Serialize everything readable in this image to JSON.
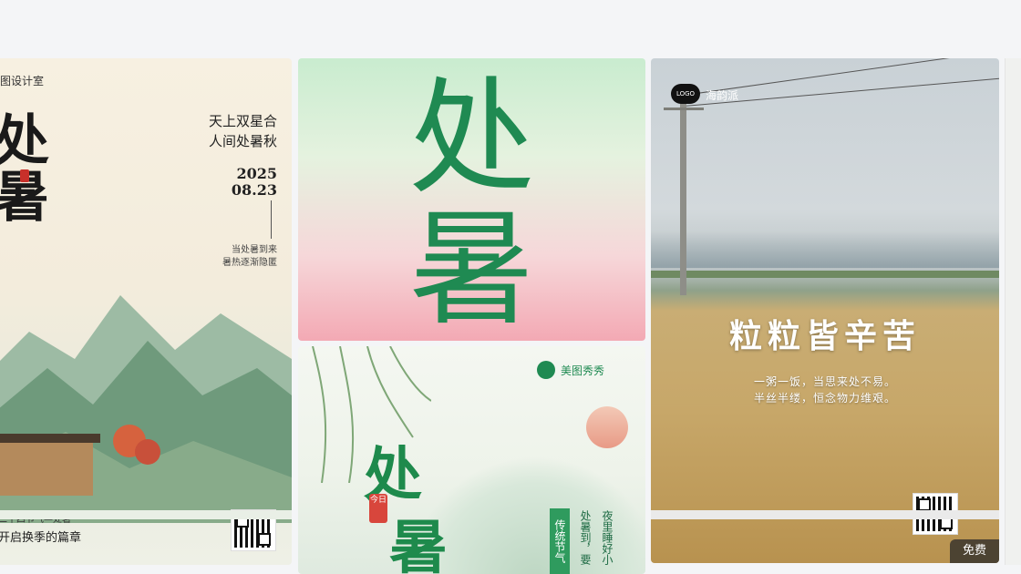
{
  "cards": {
    "card1": {
      "studio": "图设计室",
      "big_char": "处\n暑",
      "poem_line1": "天上双星合",
      "poem_line2": "人间处暑秋",
      "year": "2025",
      "date": "08.23",
      "small_line1": "当处暑到来",
      "small_line2": "暑热逐渐隐匿",
      "bottom_line1": "二十四节气—处暑",
      "bottom_line2": "开启换季的篇章"
    },
    "card2": {
      "char1": "处",
      "char2": "暑"
    },
    "card3": {
      "logo": "LOGO",
      "brand": "海韵派",
      "headline": "粒粒皆辛苦",
      "sub1": "一粥一饭，当思来处不易。",
      "sub2": "半丝半缕，恒念物力维艰。",
      "badge": "免费"
    },
    "card4": {
      "brand": "美图秀秀",
      "char1": "处",
      "char2": "暑",
      "stamp": "今日",
      "tag": "传统节气",
      "vtext1": "夜里睡好小",
      "vtext2": "处暑到，要"
    }
  }
}
